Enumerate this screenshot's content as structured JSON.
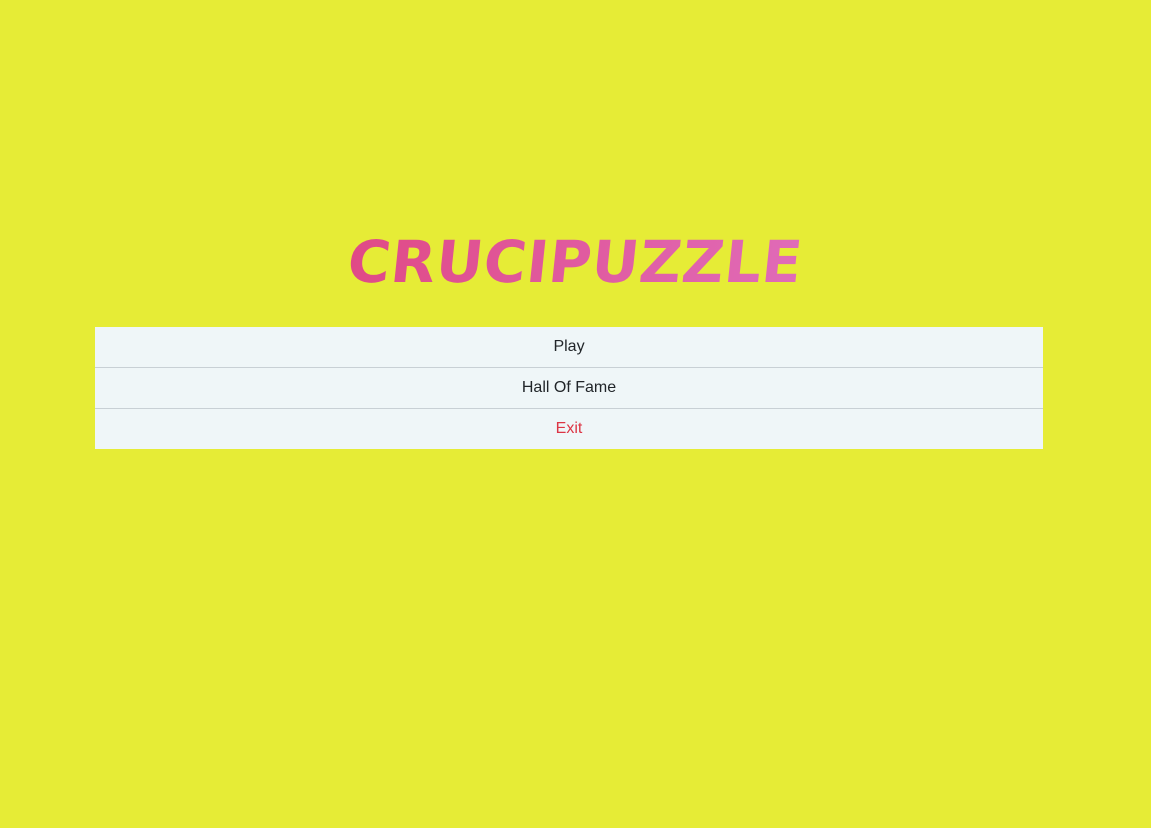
{
  "app": {
    "title": "CRUCIPUZZLE"
  },
  "menu": {
    "items": [
      {
        "label": "Play",
        "tone": "default"
      },
      {
        "label": "Hall Of Fame",
        "tone": "default"
      },
      {
        "label": "Exit",
        "tone": "danger"
      }
    ]
  },
  "colors": {
    "background": "#e6ec36",
    "title_start": "#e04a86",
    "title_end": "#e06bb8",
    "menu_bg": "#eff6f8",
    "menu_divider": "#c8d0d5",
    "text_default": "#212529",
    "text_danger": "#dc3545"
  }
}
